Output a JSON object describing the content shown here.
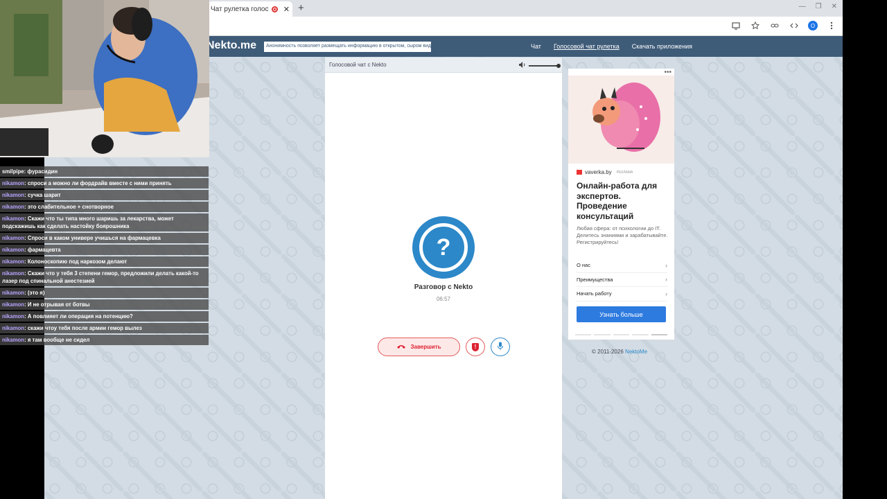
{
  "browser": {
    "tab_title": "Чат рулетка голосов",
    "new_tab": "+",
    "close_tab": "✕",
    "profile_initial": "O",
    "win_min": "—",
    "win_max": "❐",
    "win_close": "✕"
  },
  "site": {
    "logo": "Nekto.me",
    "anon_note": "Анонимность позволяет размещать информацию в открытом, сыром виде!",
    "nav": [
      "Чат",
      "Голосовой чат рулетка",
      "Скачать приложения"
    ]
  },
  "chat": {
    "header": "Голосовой чат с Nekto",
    "avatar_symbol": "?",
    "title": "Разговор с Nekto",
    "timer": "06:57",
    "end_label": "Завершить"
  },
  "ad": {
    "source": "vaverka.by",
    "tag": "РЕКЛАМА",
    "title": "Онлайн-работа для экспертов. Проведение консультаций",
    "description": "Любая сфера: от психологии до IT. Делитесь знаниями и зарабатывайте. Регистрируйтесь!",
    "items": [
      "О нас",
      "Преимущества",
      "Начать работу"
    ],
    "cta": "Узнать больше",
    "menu": "•••"
  },
  "footer": {
    "copyright": "© 2011-2026",
    "link": "NektoMe"
  },
  "stream_chat": [
    {
      "user": "smilpipe",
      "text": ": фурасидин"
    },
    {
      "user": "nikamon",
      "text": ": спроси а можно ли фордрайв вместе с ними принять"
    },
    {
      "user": "nikamon",
      "text": ": сучка шарит"
    },
    {
      "user": "nikamon",
      "text": ": это слабительное + снотворное"
    },
    {
      "user": "nikamon",
      "text": ": Скажи что ты типа много шаришь за лекарства, может подскажишь как сделать настойку боярошника"
    },
    {
      "user": "nikamon",
      "text": ": Спроси в каком универе учишься на фармацевка"
    },
    {
      "user": "nikamon",
      "text": ": фармацевта"
    },
    {
      "user": "nikamon",
      "text": ": Колоноскопию под наркозом делают"
    },
    {
      "user": "nikamon",
      "text": ": Скажи что у тебя 3 степени гемор, предложили делать какой-то лазер под спинальной анестезией"
    },
    {
      "user": "nikamon",
      "text": ": (это я)"
    },
    {
      "user": "nikamon",
      "text": ": И не отрывая от ботвы"
    },
    {
      "user": "nikamon",
      "text": ": А повлияет ли операция на потенцию?"
    },
    {
      "user": "nikamon",
      "text": ": скажи чтоу тебя после армии гемор вылез"
    },
    {
      "user": "nikamon",
      "text": ": я там вообще не сидел"
    }
  ]
}
